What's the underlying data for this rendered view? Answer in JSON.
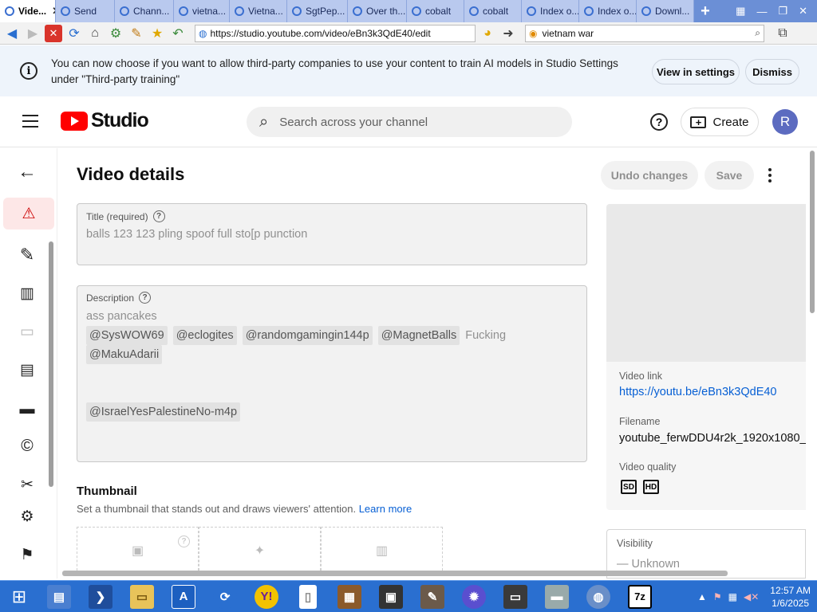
{
  "browser": {
    "tabs": [
      {
        "label": "Vide...",
        "active": true
      },
      {
        "label": "Send"
      },
      {
        "label": "Chann..."
      },
      {
        "label": "vietna..."
      },
      {
        "label": "Vietna..."
      },
      {
        "label": "SgtPep..."
      },
      {
        "label": "Over th..."
      },
      {
        "label": "cobalt"
      },
      {
        "label": "cobalt"
      },
      {
        "label": "Index o..."
      },
      {
        "label": "Index o..."
      },
      {
        "label": "Downl..."
      }
    ],
    "url": "https://studio.youtube.com/video/eBn3k3QdE40/edit",
    "search_query": "vietnam war"
  },
  "banner": {
    "message": "You can now choose if you want to allow third-party companies to use your content to train AI models in Studio Settings under \"Third-party training\"",
    "view_settings": "View in settings",
    "dismiss": "Dismiss"
  },
  "studio": {
    "logo_text": "Studio",
    "search_placeholder": "Search across your channel",
    "create_label": "Create",
    "avatar_letter": "R",
    "help_glyph": "?"
  },
  "editor": {
    "page_title": "Video details",
    "undo_label": "Undo changes",
    "save_label": "Save",
    "title_label": "Title (required)",
    "title_value": "balls 123 123 pling spoof full sto[p punction",
    "description_label": "Description",
    "description_line1": "ass pancakes",
    "mentions_row1": [
      "@SysWOW69",
      "@eclogites",
      "@randomgamingin144p",
      "@MagnetBalls"
    ],
    "word_after_mentions": "Fucking",
    "mentions_row2": [
      "@MakuAdarii"
    ],
    "mentions_row3": [
      "@IsraelYesPalestineNo-m4p"
    ],
    "thumbnail_title": "Thumbnail",
    "thumbnail_subtitle": "Set a thumbnail that stands out and draws viewers' attention.",
    "learn_more": "Learn more"
  },
  "side_panel": {
    "video_link_label": "Video link",
    "video_link": "https://youtu.be/eBn3k3QdE40",
    "filename_label": "Filename",
    "filename": "youtube_ferwDDU4r2k_1920x1080_",
    "quality_label": "Video quality",
    "quality_badges": [
      "SD",
      "HD"
    ],
    "visibility_label": "Visibility",
    "visibility_value": "Unknown"
  },
  "taskbar": {
    "time": "12:57 AM",
    "date": "1/6/2025",
    "seven_zip": "7z"
  },
  "colors": {
    "youtube_red": "#ff0000",
    "link_blue": "#065fd4",
    "taskbar_blue": "#2a6fd0",
    "warn_bg": "#fde7e7"
  }
}
